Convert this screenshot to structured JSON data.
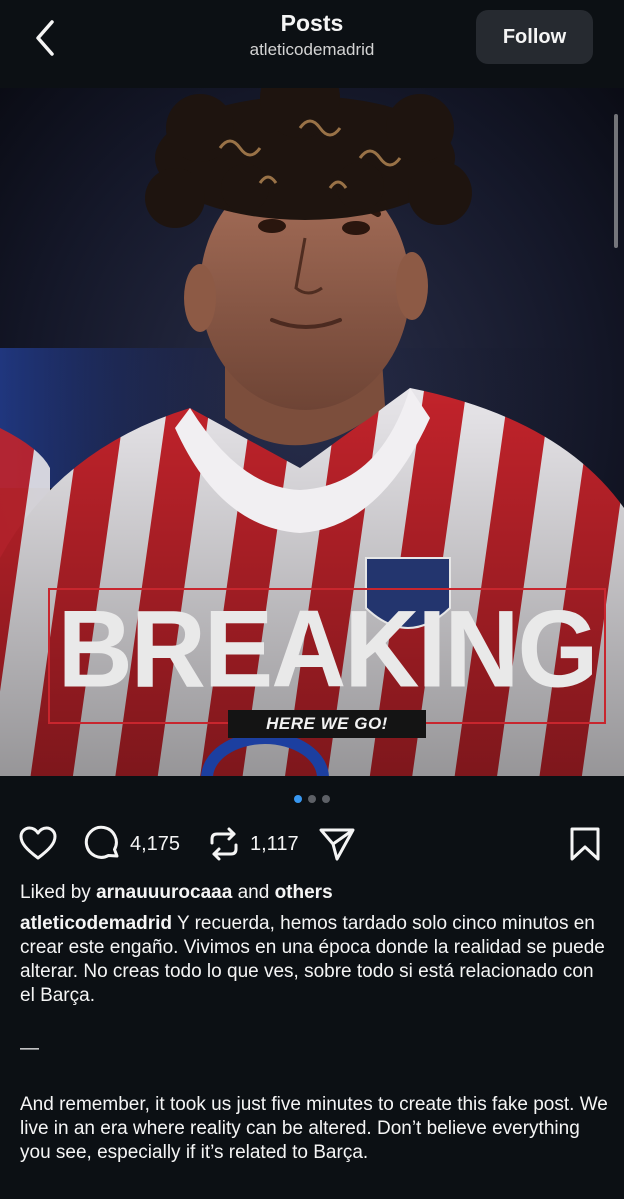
{
  "header": {
    "title": "Posts",
    "username": "atleticodemadrid",
    "follow_label": "Follow"
  },
  "post": {
    "image_headline": "BREAKING",
    "image_tagline": "HERE WE GO!",
    "carousel": {
      "total": 3,
      "active_index": 0
    },
    "counts": {
      "comments": "4,175",
      "reposts": "1,117"
    },
    "liked_by_prefix": "Liked by",
    "liked_by_user": "arnauuurocaaa",
    "liked_by_and": "and",
    "liked_by_others": "others",
    "caption_user": "atleticodemadrid",
    "caption_es": "Y recuerda, hemos tardado solo cinco minutos en crear este engaño. Vivimos en una época donde la realidad se puede alterar. No creas todo lo que ves, sobre todo si está relacionado con el Barça.",
    "caption_dash": "—",
    "caption_en": "And remember, it took us just five minutes to create this fake post. We live in an era where reality can be altered. Don’t believe everything you see, especially if it’s related to Barça."
  },
  "colors": {
    "background": "#0c1014",
    "accent_blue": "#3897f0",
    "jersey_red": "#c8262e"
  },
  "icons": {
    "back": "chevron-left-icon",
    "like": "heart-icon",
    "comment": "comment-bubble-icon",
    "repost": "repost-icon",
    "share": "send-icon",
    "save": "bookmark-icon"
  }
}
